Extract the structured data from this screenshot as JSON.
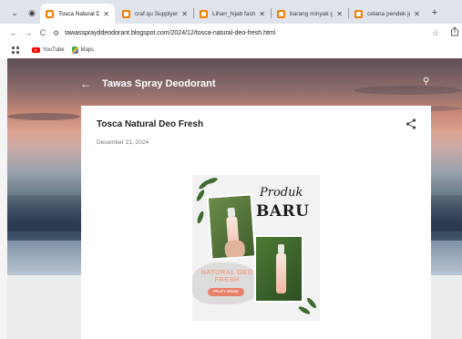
{
  "tabs": [
    {
      "title": "Tosca Natural Deo Fres",
      "active": true
    },
    {
      "title": "craf.qu Supplyer hijab",
      "active": false
    },
    {
      "title": "Lihan_hijab fashion",
      "active": false
    },
    {
      "title": "barang minyak gusti",
      "active": false
    },
    {
      "title": "celana pendek jeans p",
      "active": false
    }
  ],
  "tab_close": "✕",
  "new_tab": "+",
  "toolbar": {
    "back": "←",
    "forward": "→",
    "reload": "C",
    "url": "tawassprayddeodorant.blogspot.com/2024/12/tosca-natural-deo-fresh.html",
    "star": "☆"
  },
  "bookmarks": [
    {
      "label": "YouTube",
      "icon": "youtube-icon"
    },
    {
      "label": "Maps",
      "icon": "maps-icon"
    }
  ],
  "blog": {
    "name": "Tawas Spray Deodorant",
    "back": "←",
    "search": "⚲"
  },
  "post": {
    "title": "Tosca Natural Deo Fresh",
    "date": "Desember 21, 2024"
  },
  "promo": {
    "produk": "Produk",
    "baru": "BARU",
    "natural": "NATURAL DEO FRESH",
    "variant": "FRUITY SENSE"
  },
  "colors": {
    "tabstrip": "#dfe3eb",
    "blogger_orange": "#f57d00",
    "accent_salmon": "#e8816b"
  }
}
